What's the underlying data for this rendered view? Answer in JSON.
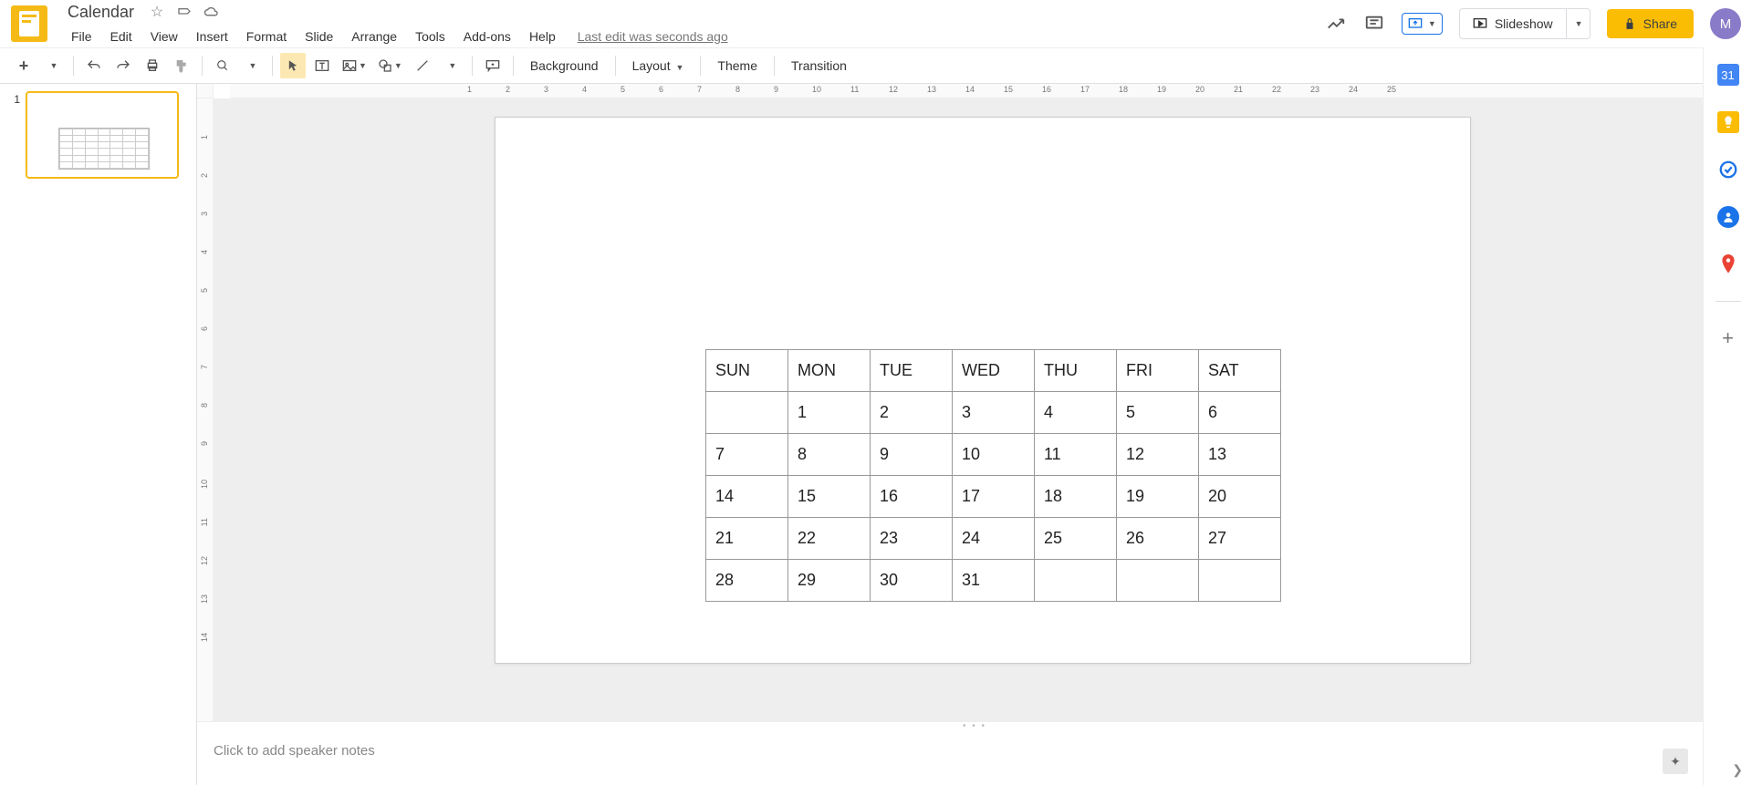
{
  "app": {
    "title": "Calendar"
  },
  "menubar": {
    "items": [
      "File",
      "Edit",
      "View",
      "Insert",
      "Format",
      "Slide",
      "Arrange",
      "Tools",
      "Add-ons",
      "Help"
    ],
    "last_edit": "Last edit was seconds ago"
  },
  "header": {
    "slideshow_label": "Slideshow",
    "share_label": "Share",
    "avatar_letter": "M"
  },
  "toolbar": {
    "background": "Background",
    "layout": "Layout",
    "theme": "Theme",
    "transition": "Transition"
  },
  "slidepanel": {
    "slides": [
      {
        "number": "1"
      }
    ]
  },
  "ruler_h": [
    "1",
    "2",
    "3",
    "4",
    "5",
    "6",
    "7",
    "8",
    "9",
    "10",
    "11",
    "12",
    "13",
    "14",
    "15",
    "16",
    "17",
    "18",
    "19",
    "20",
    "21",
    "22",
    "23",
    "24",
    "25"
  ],
  "ruler_v": [
    "1",
    "2",
    "3",
    "4",
    "5",
    "6",
    "7",
    "8",
    "9",
    "10",
    "11",
    "12",
    "13",
    "14"
  ],
  "calendar": {
    "headers": [
      "SUN",
      "MON",
      "TUE",
      "WED",
      "THU",
      "FRI",
      "SAT"
    ],
    "rows": [
      [
        "",
        "1",
        "2",
        "3",
        "4",
        "5",
        "6"
      ],
      [
        "7",
        "8",
        "9",
        "10",
        "11",
        "12",
        "13"
      ],
      [
        "14",
        "15",
        "16",
        "17",
        "18",
        "19",
        "20"
      ],
      [
        "21",
        "22",
        "23",
        "24",
        "25",
        "26",
        "27"
      ],
      [
        "28",
        "29",
        "30",
        "31",
        "",
        "",
        ""
      ]
    ]
  },
  "notes": {
    "placeholder": "Click to add speaker notes"
  }
}
